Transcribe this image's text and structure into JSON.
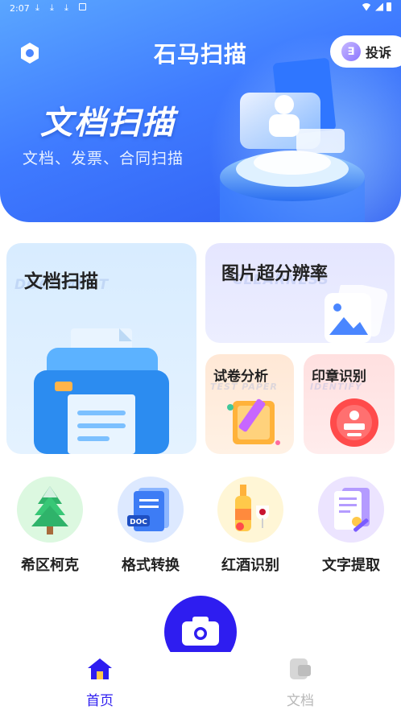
{
  "status_bar": {
    "time": "2:07",
    "icons": [
      "download-icon",
      "download-icon",
      "download-icon",
      "photo-icon"
    ]
  },
  "header": {
    "title": "石马扫描",
    "complain_label": "投诉"
  },
  "hero": {
    "title": "文档扫描",
    "subtitle": "文档、发票、合同扫描"
  },
  "cards": {
    "scan": {
      "title": "文档扫描",
      "ghost": "DOCUMENT"
    },
    "hd": {
      "title": "图片超分辨率",
      "ghost": "CLEARNESS"
    },
    "exam": {
      "title": "试卷分析",
      "ghost": "TEST PAPER"
    },
    "seal": {
      "title": "印章识别",
      "ghost": "IDENTIFY"
    }
  },
  "tools": [
    {
      "label": "希区柯克",
      "icon": "tree-icon",
      "bg": "#dcf8e0"
    },
    {
      "label": "格式转换",
      "icon": "doc-convert-icon",
      "bg": "#dde9ff"
    },
    {
      "label": "红酒识别",
      "icon": "wine-icon",
      "bg": "#fff6d6"
    },
    {
      "label": "文字提取",
      "icon": "text-extract-icon",
      "bg": "#ece4ff"
    }
  ],
  "nav": {
    "home": "首页",
    "docs": "文档"
  },
  "colors": {
    "accent": "#2e1df0",
    "banner": "#3f7bff"
  }
}
